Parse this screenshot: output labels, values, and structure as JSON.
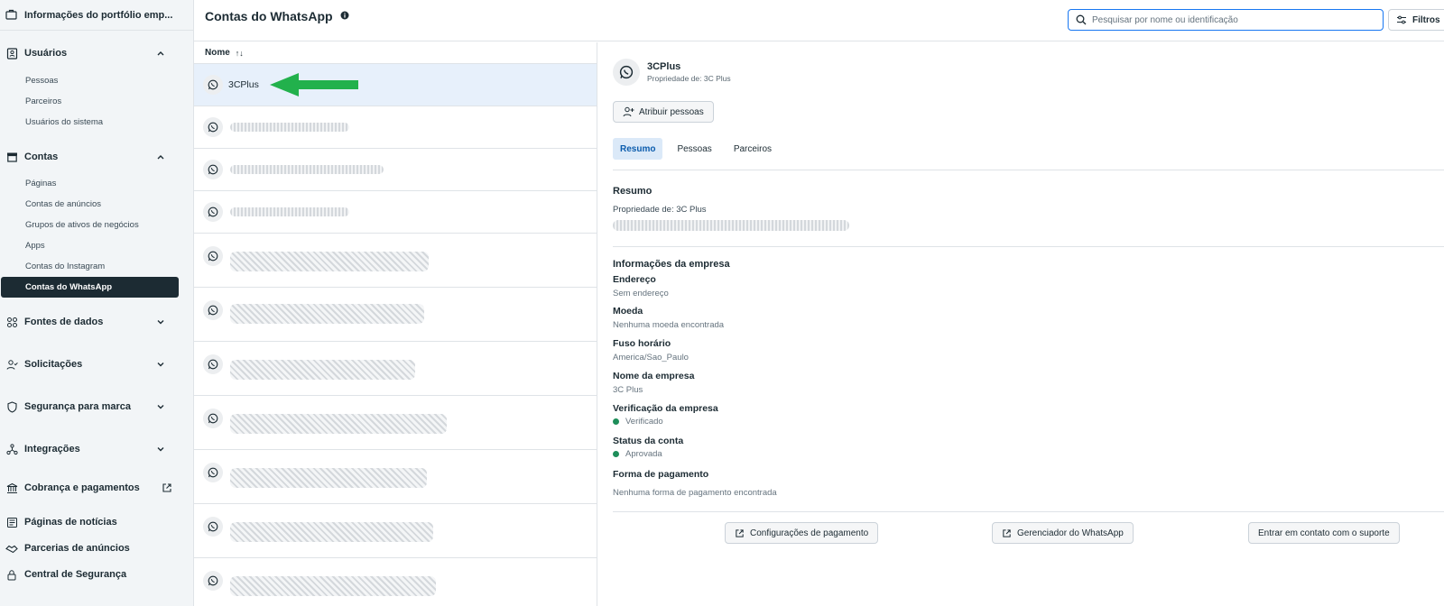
{
  "sidebar": {
    "top_item": "Informações do portfólio emp...",
    "sections": [
      {
        "label": "Usuários",
        "items": [
          "Pessoas",
          "Parceiros",
          "Usuários do sistema"
        ]
      },
      {
        "label": "Contas",
        "items": [
          "Páginas",
          "Contas de anúncios",
          "Grupos de ativos de negócios",
          "Apps",
          "Contas do Instagram",
          "Contas do WhatsApp"
        ]
      }
    ],
    "collapsed": [
      "Fontes de dados",
      "Solicitações",
      "Segurança para marca",
      "Integrações"
    ],
    "billing": "Cobrança e pagamentos",
    "bottom": [
      "Páginas de notícias",
      "Parcerias de anúncios",
      "Central de Segurança"
    ]
  },
  "header": {
    "title": "Contas do WhatsApp",
    "search_placeholder": "Pesquisar por nome ou identificação",
    "filters_label": "Filtros"
  },
  "list": {
    "column_header": "Nome",
    "sort_icon": "↑↓",
    "selected_name": "3CPlus"
  },
  "detail": {
    "account_name": "3CPlus",
    "owner": "Propriedade de: 3C Plus",
    "assign_button": "Atribuir pessoas",
    "tabs": [
      "Resumo",
      "Pessoas",
      "Parceiros"
    ],
    "summary_title": "Resumo",
    "summary_owner": "Propriedade de: 3C Plus",
    "company_title": "Informações da empresa",
    "fields": [
      {
        "label": "Endereço",
        "value": "Sem endereço"
      },
      {
        "label": "Moeda",
        "value": "Nenhuma moeda encontrada"
      },
      {
        "label": "Fuso horário",
        "value": "America/Sao_Paulo"
      },
      {
        "label": "Nome da empresa",
        "value": "3C Plus"
      },
      {
        "label": "Verificação da empresa",
        "value": "Verificado"
      },
      {
        "label": "Status da conta",
        "value": "Aprovada"
      }
    ],
    "payment_title": "Forma de pagamento",
    "payment_value": "Nenhuma forma de pagamento encontrada",
    "actions": [
      "Configurações de pagamento",
      "Gerenciador do WhatsApp",
      "Entrar em contato com o suporte"
    ]
  },
  "colors": {
    "accent": "#1877f2",
    "arrow": "#22b14c",
    "active_nav": "#1c2b33",
    "verified": "#1e8e5a"
  }
}
